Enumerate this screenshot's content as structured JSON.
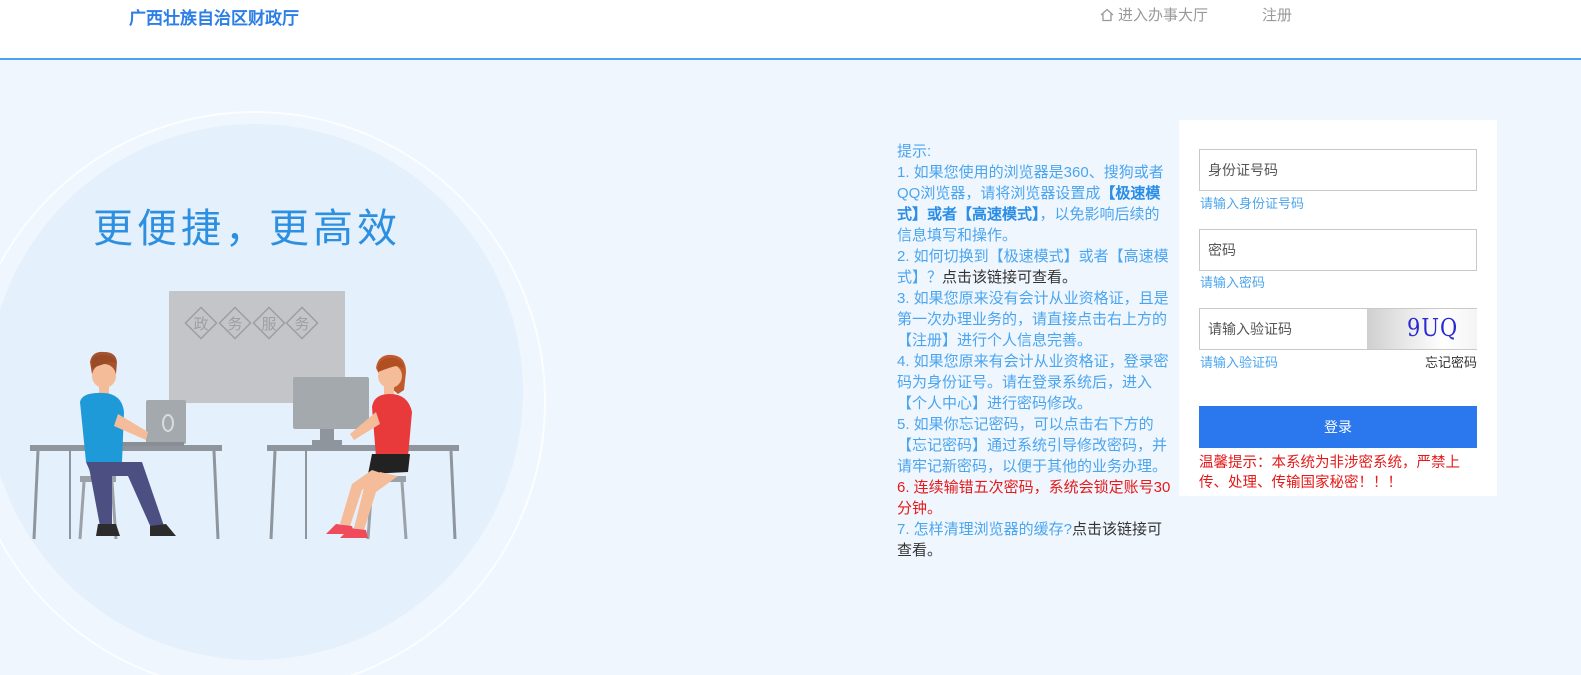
{
  "header": {
    "brand": "广西壮族自治区财政厅",
    "nav_hall": "进入办事大厅",
    "nav_register": "注册"
  },
  "illustration": {
    "slogan": "更便捷，更高效",
    "board_chars": [
      "政",
      "务",
      "服",
      "务"
    ]
  },
  "tips": {
    "title": "提示:",
    "t1_a": "1. 如果您使用的浏览器是360、搜狗或者QQ浏览器，请将浏览器设置成",
    "t1_b": "【极速模式】或者【高速模式】",
    "t1_c": "，以免影响后续的信息填写和操作。",
    "t2_a": "2. 如何切换到【极速模式】或者【高速模式】？",
    "t2_link": "点击该链接可查看。",
    "t3": "3. 如果您原来没有会计从业资格证，且是第一次办理业务的，请直接点击右上方的【注册】进行个人信息完善。",
    "t4": "4. 如果您原来有会计从业资格证，登录密码为身份证号。请在登录系统后，进入【个人中心】进行密码修改。",
    "t5": "5. 如果你忘记密码，可以点击右下方的【忘记密码】通过系统引导修改密码，并请牢记新密码，以便于其他的业务办理。",
    "t6": "6. 连续输错五次密码，系统会锁定账号30分钟。",
    "t7_a": "7. 怎样清理浏览器的缓存?",
    "t7_link": "点击该链接可查看。"
  },
  "login": {
    "id_placeholder": "身份证号码",
    "id_hint": "请输入身份证号码",
    "pwd_placeholder": "密码",
    "pwd_hint": "请输入密码",
    "captcha_placeholder": "请输入验证码",
    "captcha_text": "9UQ",
    "captcha_hint": "请输入验证码",
    "forgot": "忘记密码",
    "submit": "登录",
    "warning": "温馨提示：本系统为非涉密系统，严禁上传、处理、传输国家秘密！！！"
  },
  "colors": {
    "brand": "#2a7ee6",
    "accent": "#4ba5ee",
    "button": "#2a77ee",
    "warning": "#e61a1a",
    "background": "#eff6fe"
  },
  "icons": {
    "nav_hall": "home-icon"
  }
}
